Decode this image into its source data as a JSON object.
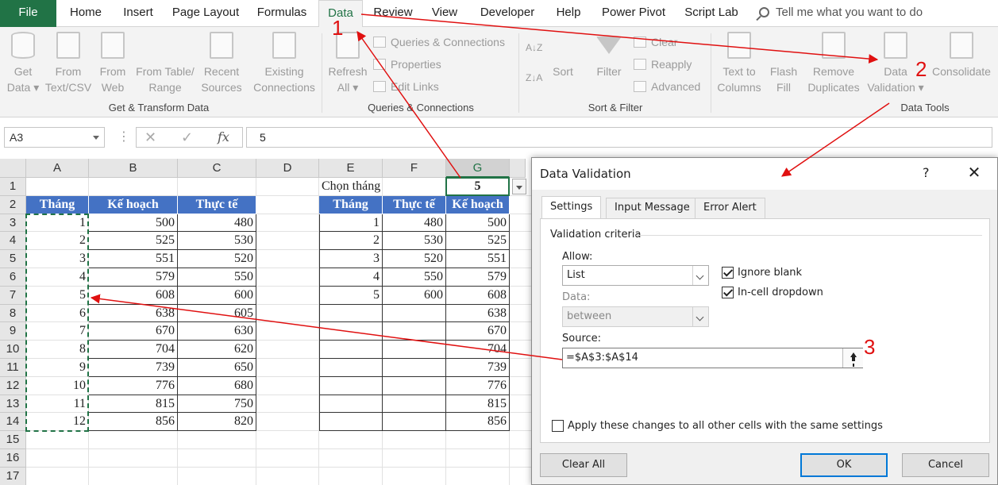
{
  "ribbon_tabs": [
    "File",
    "Home",
    "Insert",
    "Page Layout",
    "Formulas",
    "Data",
    "Review",
    "View",
    "Developer",
    "Help",
    "Power Pivot",
    "Script Lab"
  ],
  "active_tab": "Data",
  "tell_me": "Tell me what you want to do",
  "ribbon": {
    "get_transform": {
      "group": "Get & Transform Data",
      "buttons": [
        {
          "l1": "Get",
          "l2": "Data ▾"
        },
        {
          "l1": "From",
          "l2": "Text/CSV"
        },
        {
          "l1": "From",
          "l2": "Web"
        },
        {
          "l1": "From Table/",
          "l2": "Range"
        },
        {
          "l1": "Recent",
          "l2": "Sources"
        },
        {
          "l1": "Existing",
          "l2": "Connections"
        }
      ]
    },
    "queries": {
      "group": "Queries & Connections",
      "refresh_l1": "Refresh",
      "refresh_l2": "All ▾",
      "items": [
        "Queries & Connections",
        "Properties",
        "Edit Links"
      ]
    },
    "sort_filter": {
      "group": "Sort & Filter",
      "sort": "Sort",
      "filter": "Filter",
      "items": [
        "Clear",
        "Reapply",
        "Advanced"
      ]
    },
    "data_tools": {
      "group": "Data Tools",
      "buttons": [
        {
          "l1": "Text to",
          "l2": "Columns"
        },
        {
          "l1": "Flash",
          "l2": "Fill"
        },
        {
          "l1": "Remove",
          "l2": "Duplicates"
        },
        {
          "l1": "Data",
          "l2": "Validation ▾"
        },
        {
          "l1": "Consolidate",
          "l2": ""
        }
      ]
    }
  },
  "formula_bar": {
    "name_box": "A3",
    "value": "5"
  },
  "grid": {
    "columns": [
      "A",
      "B",
      "C",
      "D",
      "E",
      "F",
      "G"
    ],
    "rows": [
      "1",
      "2",
      "3",
      "4",
      "5",
      "6",
      "7",
      "8",
      "9",
      "10",
      "11",
      "12",
      "13",
      "14",
      "15",
      "16",
      "17"
    ],
    "label_e1": "Chọn tháng",
    "value_g1": "5",
    "table1_headers": [
      "Tháng",
      "Kế hoạch",
      "Thực tế"
    ],
    "table1": [
      [
        "1",
        "500",
        "480"
      ],
      [
        "2",
        "525",
        "530"
      ],
      [
        "3",
        "551",
        "520"
      ],
      [
        "4",
        "579",
        "550"
      ],
      [
        "5",
        "608",
        "600"
      ],
      [
        "6",
        "638",
        "605"
      ],
      [
        "7",
        "670",
        "630"
      ],
      [
        "8",
        "704",
        "620"
      ],
      [
        "9",
        "739",
        "650"
      ],
      [
        "10",
        "776",
        "680"
      ],
      [
        "11",
        "815",
        "750"
      ],
      [
        "12",
        "856",
        "820"
      ]
    ],
    "table2_headers": [
      "Tháng",
      "Thực tế",
      "Kế hoạch"
    ],
    "table2": [
      [
        "1",
        "480",
        "500"
      ],
      [
        "2",
        "530",
        "525"
      ],
      [
        "3",
        "520",
        "551"
      ],
      [
        "4",
        "550",
        "579"
      ],
      [
        "5",
        "600",
        "608"
      ],
      [
        "",
        "",
        "638"
      ],
      [
        "",
        "",
        "670"
      ],
      [
        "",
        "",
        "704"
      ],
      [
        "",
        "",
        "739"
      ],
      [
        "",
        "",
        "776"
      ],
      [
        "",
        "",
        "815"
      ],
      [
        "",
        "",
        "856"
      ]
    ]
  },
  "dialog": {
    "title": "Data Validation",
    "help": "?",
    "close": "✕",
    "tabs": [
      "Settings",
      "Input Message",
      "Error Alert"
    ],
    "criteria": "Validation criteria",
    "allow_label": "Allow:",
    "allow_value": "List",
    "data_label": "Data:",
    "data_value": "between",
    "ignore_blank": "Ignore blank",
    "in_cell_dropdown": "In-cell dropdown",
    "source_label": "Source:",
    "source_value": "=$A$3:$A$14",
    "apply_all": "Apply these changes to all other cells with the same settings",
    "clear_all": "Clear All",
    "ok": "OK",
    "cancel": "Cancel"
  },
  "annotations": [
    "1",
    "2",
    "3"
  ],
  "colors": {
    "excel_green": "#217346",
    "header_blue": "#4472c4",
    "annotation_red": "#e01010"
  }
}
